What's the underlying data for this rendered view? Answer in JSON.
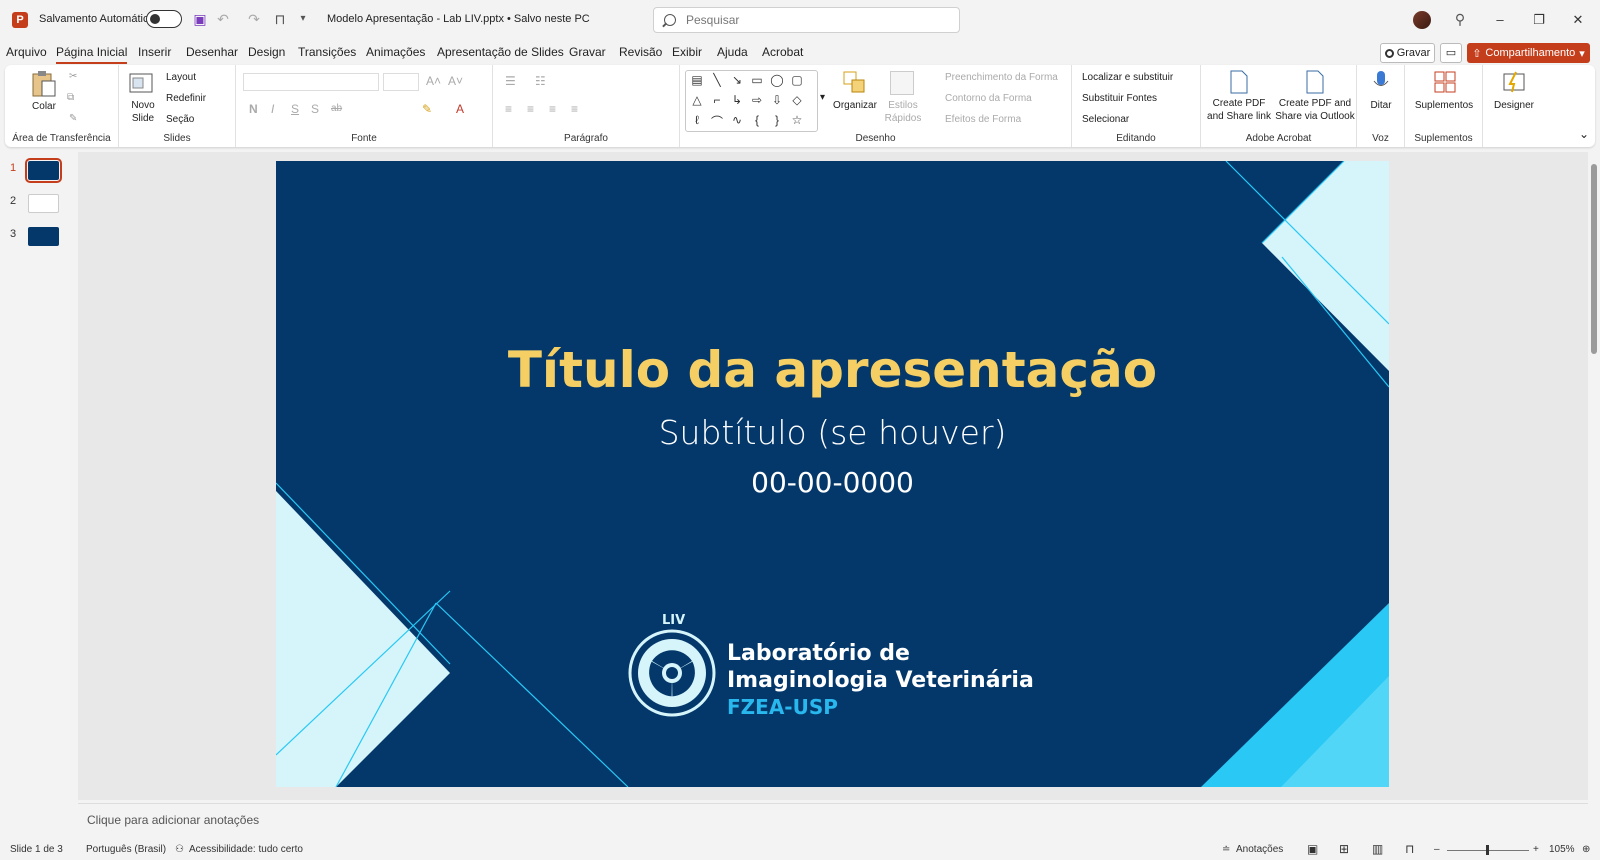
{
  "titlebar": {
    "app_letter": "P",
    "autosave_label": "Salvamento Automático",
    "document_title": "Modelo Apresentação - Lab LIV.pptx • Salvo neste PC",
    "search_placeholder": "Pesquisar",
    "minimize": "–",
    "restore": "❐",
    "close": "✕"
  },
  "menu": {
    "tabs": [
      "Arquivo",
      "Página Inicial",
      "Inserir",
      "Desenhar",
      "Design",
      "Transições",
      "Animações",
      "Apresentação de Slides",
      "Gravar",
      "Revisão",
      "Exibir",
      "Ajuda",
      "Acrobat"
    ],
    "active_index": 1,
    "record_label": "Gravar",
    "share_label": "Compartilhamento"
  },
  "ribbon": {
    "clipboard": {
      "paste": "Colar",
      "group": "Área de Transferência"
    },
    "slides": {
      "new_slide": "Novo Slide",
      "layout": "Layout",
      "reset": "Redefinir",
      "section": "Seção",
      "group": "Slides"
    },
    "font": {
      "bold": "N",
      "italic": "I",
      "underline": "S",
      "shadow": "S",
      "strike": "ab",
      "group": "Fonte"
    },
    "paragraph": {
      "group": "Parágrafo"
    },
    "drawing": {
      "arrange": "Organizar",
      "quick_styles": "Estilos Rápidos",
      "fill": "Preenchimento da Forma",
      "outline": "Contorno da Forma",
      "effects": "Efeitos de Forma",
      "group": "Desenho"
    },
    "editing": {
      "find": "Localizar e substituir",
      "replace_fonts": "Substituir Fontes",
      "select": "Selecionar",
      "group": "Editando"
    },
    "acrobat": {
      "create_pdf": "Create PDF and Share link",
      "create_pdf_outlook": "Create PDF and Share via Outlook",
      "group": "Adobe Acrobat"
    },
    "voice": {
      "dictate": "Ditar",
      "group": "Voz"
    },
    "addins": {
      "addins": "Suplementos",
      "group": "Suplementos"
    },
    "designer": {
      "label": "Designer"
    }
  },
  "thumbnails": [
    "1",
    "2",
    "3"
  ],
  "slide": {
    "title": "Título da apresentação",
    "subtitle": "Subtítulo (se houver)",
    "date": "00-00-0000",
    "logo_line1": "Laboratório de",
    "logo_line2": "Imaginologia Veterinária",
    "logo_line3": "FZEA-USP",
    "logo_badge": "LIV",
    "colors": {
      "background": "#04386b",
      "title": "#f5cf63",
      "accent_light": "#d5f5fb",
      "accent_cyan": "#29c8f5"
    }
  },
  "notes": {
    "placeholder": "Clique para adicionar anotações"
  },
  "status": {
    "slide_counter": "Slide 1 de 3",
    "language": "Português (Brasil)",
    "accessibility": "Acessibilidade: tudo certo",
    "notes_button": "Anotações",
    "zoom": "105%"
  }
}
